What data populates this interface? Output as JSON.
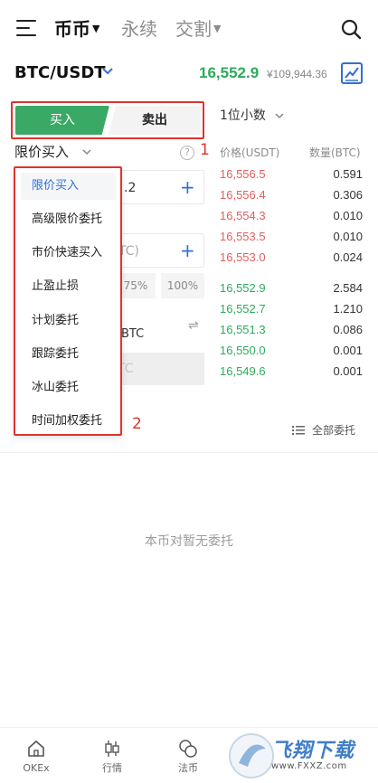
{
  "nav": {
    "tabs": [
      {
        "label": "币币"
      },
      {
        "label": "永续"
      },
      {
        "label": "交割"
      }
    ],
    "caret": "▼"
  },
  "pair": {
    "symbol": "BTC/USDT",
    "last_price": "16,552.9",
    "fiat_price": "¥109,944.36"
  },
  "trade": {
    "buy_label": "买入",
    "sell_label": "卖出",
    "order_type": "限价买入",
    "help": "?"
  },
  "annotations": {
    "marker_1": "1",
    "marker_2": "2"
  },
  "form": {
    "price_suffix": ".2",
    "amount_suffix": "TC)",
    "percent_options": [
      "75%",
      "100%"
    ],
    "available_suffix": "BTC",
    "submit_suffix": "TC",
    "plus": "+",
    "swap": "⇌"
  },
  "order_book": {
    "precision": "1位小数",
    "price_header": "价格(USDT)",
    "qty_header": "数量(BTC)",
    "asks": [
      {
        "price": "16,556.5",
        "qty": "0.591"
      },
      {
        "price": "16,556.4",
        "qty": "0.306"
      },
      {
        "price": "16,554.3",
        "qty": "0.010"
      },
      {
        "price": "16,553.5",
        "qty": "0.010"
      },
      {
        "price": "16,553.0",
        "qty": "0.024"
      }
    ],
    "bids": [
      {
        "price": "16,552.9",
        "qty": "2.584"
      },
      {
        "price": "16,552.7",
        "qty": "1.210"
      },
      {
        "price": "16,551.3",
        "qty": "0.086"
      },
      {
        "price": "16,550.0",
        "qty": "0.001"
      },
      {
        "price": "16,549.6",
        "qty": "0.001"
      }
    ]
  },
  "dropdown": {
    "items": [
      {
        "label": "限价买入",
        "selected": true
      },
      {
        "label": "高级限价委托"
      },
      {
        "label": "市价快速买入"
      },
      {
        "label": "止盈止损"
      },
      {
        "label": "计划委托"
      },
      {
        "label": "跟踪委托"
      },
      {
        "label": "冰山委托"
      },
      {
        "label": "时间加权委托"
      }
    ]
  },
  "orders": {
    "all_orders_label": "全部委托",
    "empty_text": "本币对暂无委托"
  },
  "bottom_nav": {
    "items": [
      {
        "label": "OKEx"
      },
      {
        "label": "行情"
      },
      {
        "label": "法币"
      }
    ]
  },
  "watermark": {
    "text": "飞翔下载",
    "url": "www.FXXZ.com"
  },
  "colors": {
    "buy_green": "#3aa965",
    "ask_red": "#e35d5d",
    "bid_green": "#2eaa5c",
    "accent_blue": "#2f6fd4",
    "annotation_red": "#e0332d"
  }
}
